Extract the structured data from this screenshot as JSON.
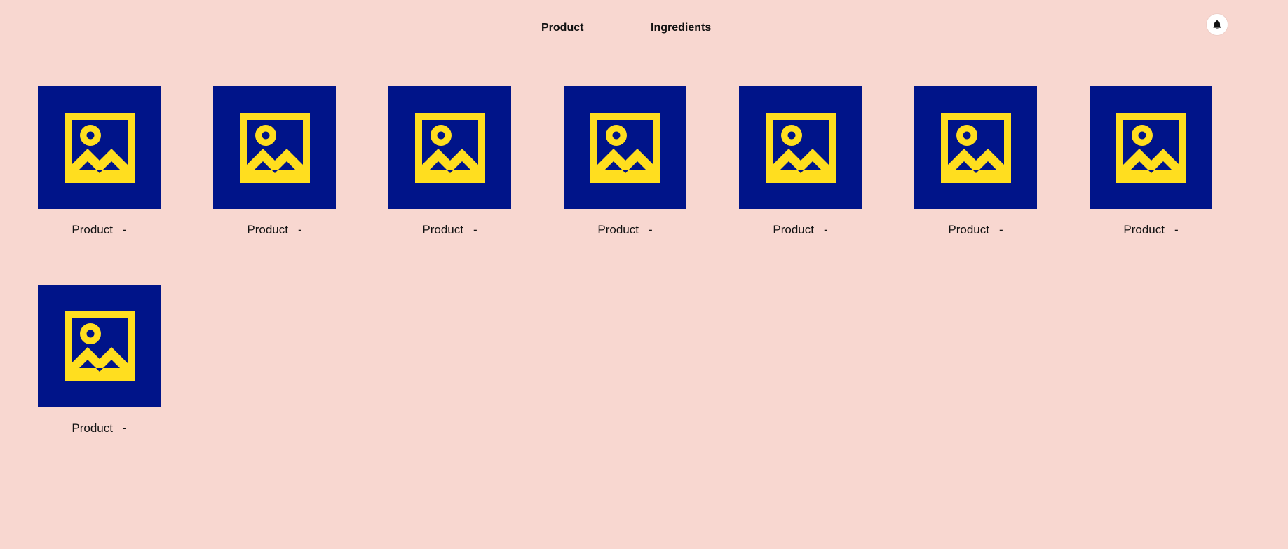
{
  "nav": {
    "product_label": "Product",
    "ingredients_label": "Ingredients"
  },
  "header": {
    "notification_icon": "bell-icon"
  },
  "product_image_icon": "image-placeholder-icon",
  "colors": {
    "background": "#f8d7d0",
    "thumbnail_bg": "#001489",
    "icon_yellow": "#ffde1f"
  },
  "products": [
    {
      "name": "Product",
      "detail": "-"
    },
    {
      "name": "Product",
      "detail": "-"
    },
    {
      "name": "Product",
      "detail": "-"
    },
    {
      "name": "Product",
      "detail": "-"
    },
    {
      "name": "Product",
      "detail": "-"
    },
    {
      "name": "Product",
      "detail": "-"
    },
    {
      "name": "Product",
      "detail": "-"
    },
    {
      "name": "Product",
      "detail": "-"
    }
  ]
}
